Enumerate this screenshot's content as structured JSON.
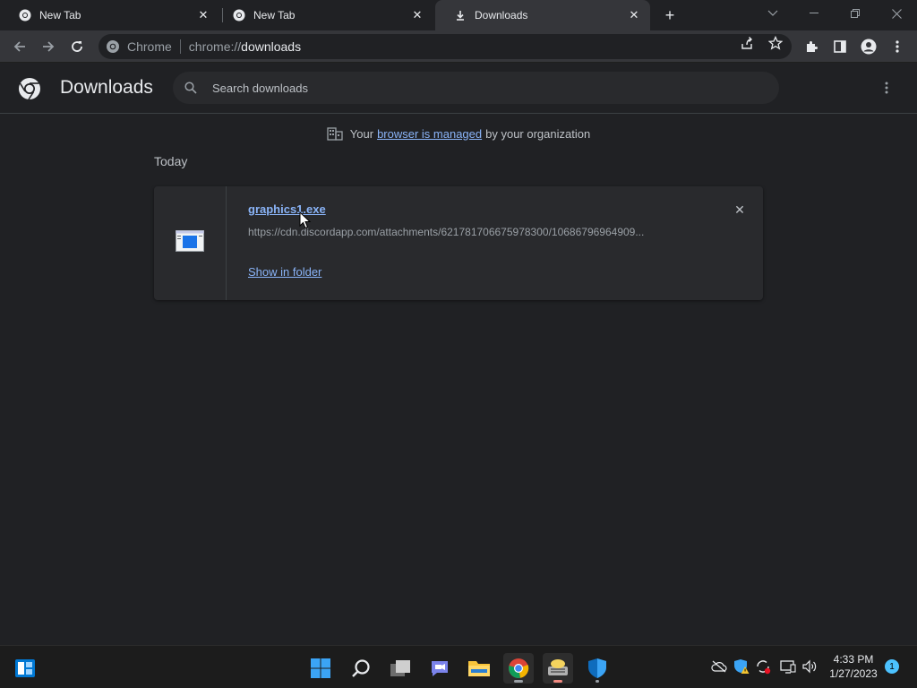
{
  "tabs": [
    {
      "title": "New Tab",
      "icon": "chrome-icon"
    },
    {
      "title": "New Tab",
      "icon": "chrome-icon"
    },
    {
      "title": "Downloads",
      "icon": "download-icon"
    }
  ],
  "omnibox": {
    "site_label": "Chrome",
    "url_scheme": "chrome://",
    "url_host": "downloads"
  },
  "downloads_page": {
    "title": "Downloads",
    "search_placeholder": "Search downloads",
    "managed_prefix": "Your",
    "managed_link": "browser is managed",
    "managed_suffix": "by your organization",
    "section_date": "Today",
    "items": [
      {
        "file_name": "graphics1.exe",
        "url": "https://cdn.discordapp.com/attachments/621781706675978300/10686796964909...",
        "action_label": "Show in folder"
      }
    ]
  },
  "taskbar": {
    "time": "4:33 PM",
    "date": "1/27/2023",
    "notification_count": "1"
  },
  "colors": {
    "background": "#202124",
    "toolbar": "#35363a",
    "link": "#8ab4f8",
    "card": "#292a2d"
  }
}
